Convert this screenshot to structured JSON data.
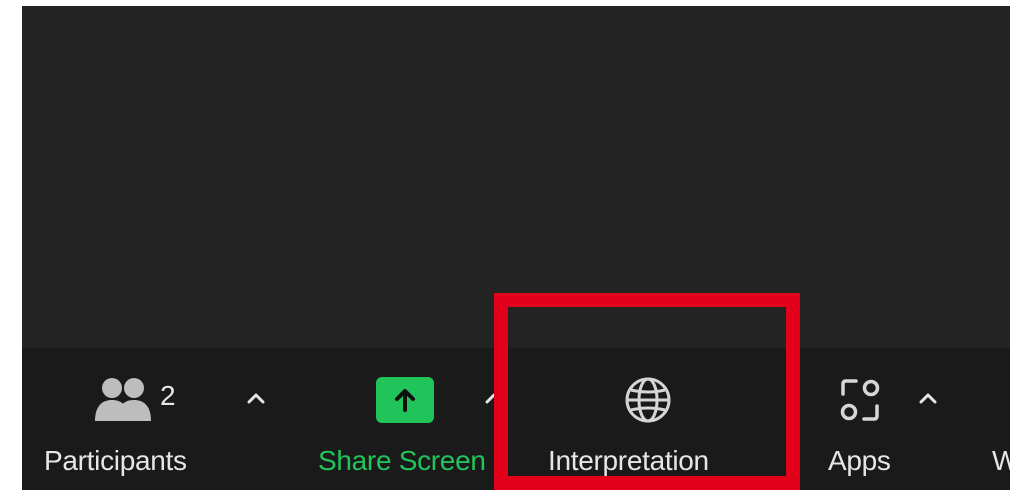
{
  "colors": {
    "stage_bg": "#232323",
    "toolbar_bg": "#1a1a1a",
    "label_text": "#e6e6e6",
    "share_accent": "#21c45a",
    "highlight_border": "#e3001b"
  },
  "toolbar": {
    "participants": {
      "icon": "people-icon",
      "count": "2",
      "label": "Participants",
      "caret_icon": "chevron-up-icon"
    },
    "share_screen": {
      "icon": "arrow-up-icon",
      "label": "Share Screen",
      "caret_icon": "chevron-up-icon"
    },
    "interpretation": {
      "icon": "globe-icon",
      "label": "Interpretation"
    },
    "apps": {
      "icon": "apps-icon",
      "label": "Apps",
      "caret_icon": "chevron-up-icon"
    },
    "next_item": {
      "label": "W"
    }
  }
}
